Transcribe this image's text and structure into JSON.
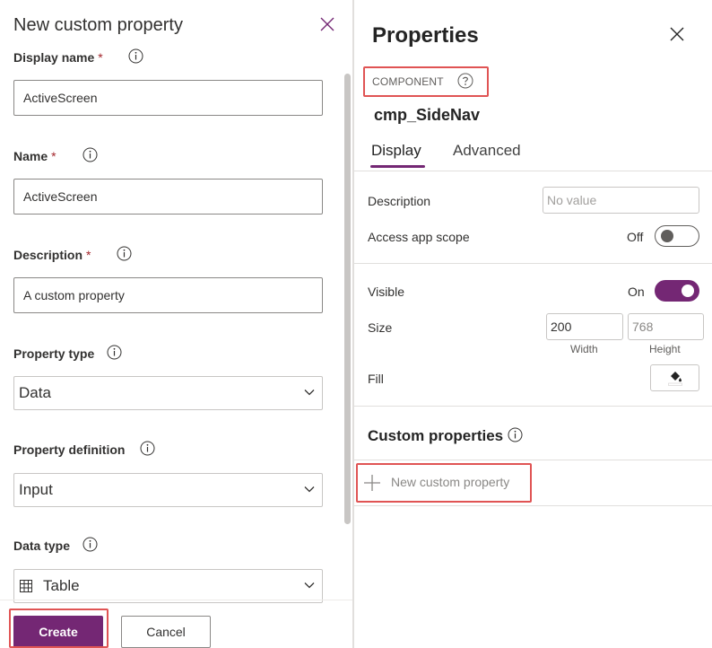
{
  "left_panel": {
    "title": "New custom property",
    "fields": {
      "display_name": {
        "label": "Display name",
        "value": "ActiveScreen"
      },
      "name": {
        "label": "Name",
        "value": "ActiveScreen"
      },
      "description": {
        "label": "Description",
        "value": "A custom property"
      },
      "property_type": {
        "label": "Property type",
        "value": "Data"
      },
      "property_definition": {
        "label": "Property definition",
        "value": "Input"
      },
      "data_type": {
        "label": "Data type",
        "value": "Table"
      }
    },
    "required_marker": "*",
    "buttons": {
      "create": "Create",
      "cancel": "Cancel"
    }
  },
  "right_panel": {
    "title": "Properties",
    "component_label": "COMPONENT",
    "component_name": "cmp_SideNav",
    "tabs": [
      {
        "label": "Display",
        "active": true
      },
      {
        "label": "Advanced",
        "active": false
      }
    ],
    "description": {
      "label": "Description",
      "placeholder": "No value"
    },
    "access_app_scope": {
      "label": "Access app scope",
      "state_text": "Off",
      "on": false
    },
    "visible": {
      "label": "Visible",
      "state_text": "On",
      "on": true
    },
    "size": {
      "label": "Size",
      "width": "200",
      "height": "768",
      "width_label": "Width",
      "height_label": "Height"
    },
    "fill": {
      "label": "Fill"
    },
    "custom_properties": {
      "title": "Custom properties",
      "new_button": "New custom property"
    }
  },
  "colors": {
    "accent": "#742774",
    "highlight": "#e05454"
  },
  "icons": [
    "close-icon",
    "info-icon",
    "help-circle-icon",
    "chevron-down-icon",
    "table-icon",
    "paint-bucket-icon",
    "plus-icon"
  ]
}
